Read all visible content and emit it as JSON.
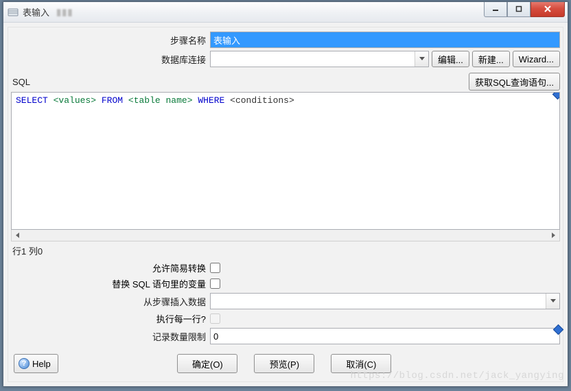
{
  "titlebar": {
    "title": "表输入"
  },
  "form": {
    "step_name_label": "步骤名称",
    "step_name_value": "表输入",
    "db_conn_label": "数据库连接",
    "db_conn_value": "",
    "edit_btn": "编辑...",
    "new_btn": "新建...",
    "wizard_btn": "Wizard..."
  },
  "sql": {
    "label": "SQL",
    "get_sql_btn": "获取SQL查询语句...",
    "kw_select": "SELECT",
    "ph_values": "<values>",
    "kw_from": "FROM",
    "ph_table": "<table name>",
    "kw_where": "WHERE",
    "ph_cond": "<conditions>",
    "status": "行1 列0"
  },
  "options": {
    "allow_lazy_label": "允许简易转换",
    "allow_lazy_checked": false,
    "replace_vars_label": "替换 SQL 语句里的变量",
    "replace_vars_checked": false,
    "from_step_label": "从步骤插入数据",
    "from_step_value": "",
    "exec_each_label": "执行每一行?",
    "exec_each_checked": false,
    "limit_label": "记录数量限制",
    "limit_value": "0"
  },
  "footer": {
    "help": "Help",
    "ok": "确定(O)",
    "preview": "预览(P)",
    "cancel": "取消(C)"
  },
  "watermark": "https://blog.csdn.net/jack_yangying"
}
